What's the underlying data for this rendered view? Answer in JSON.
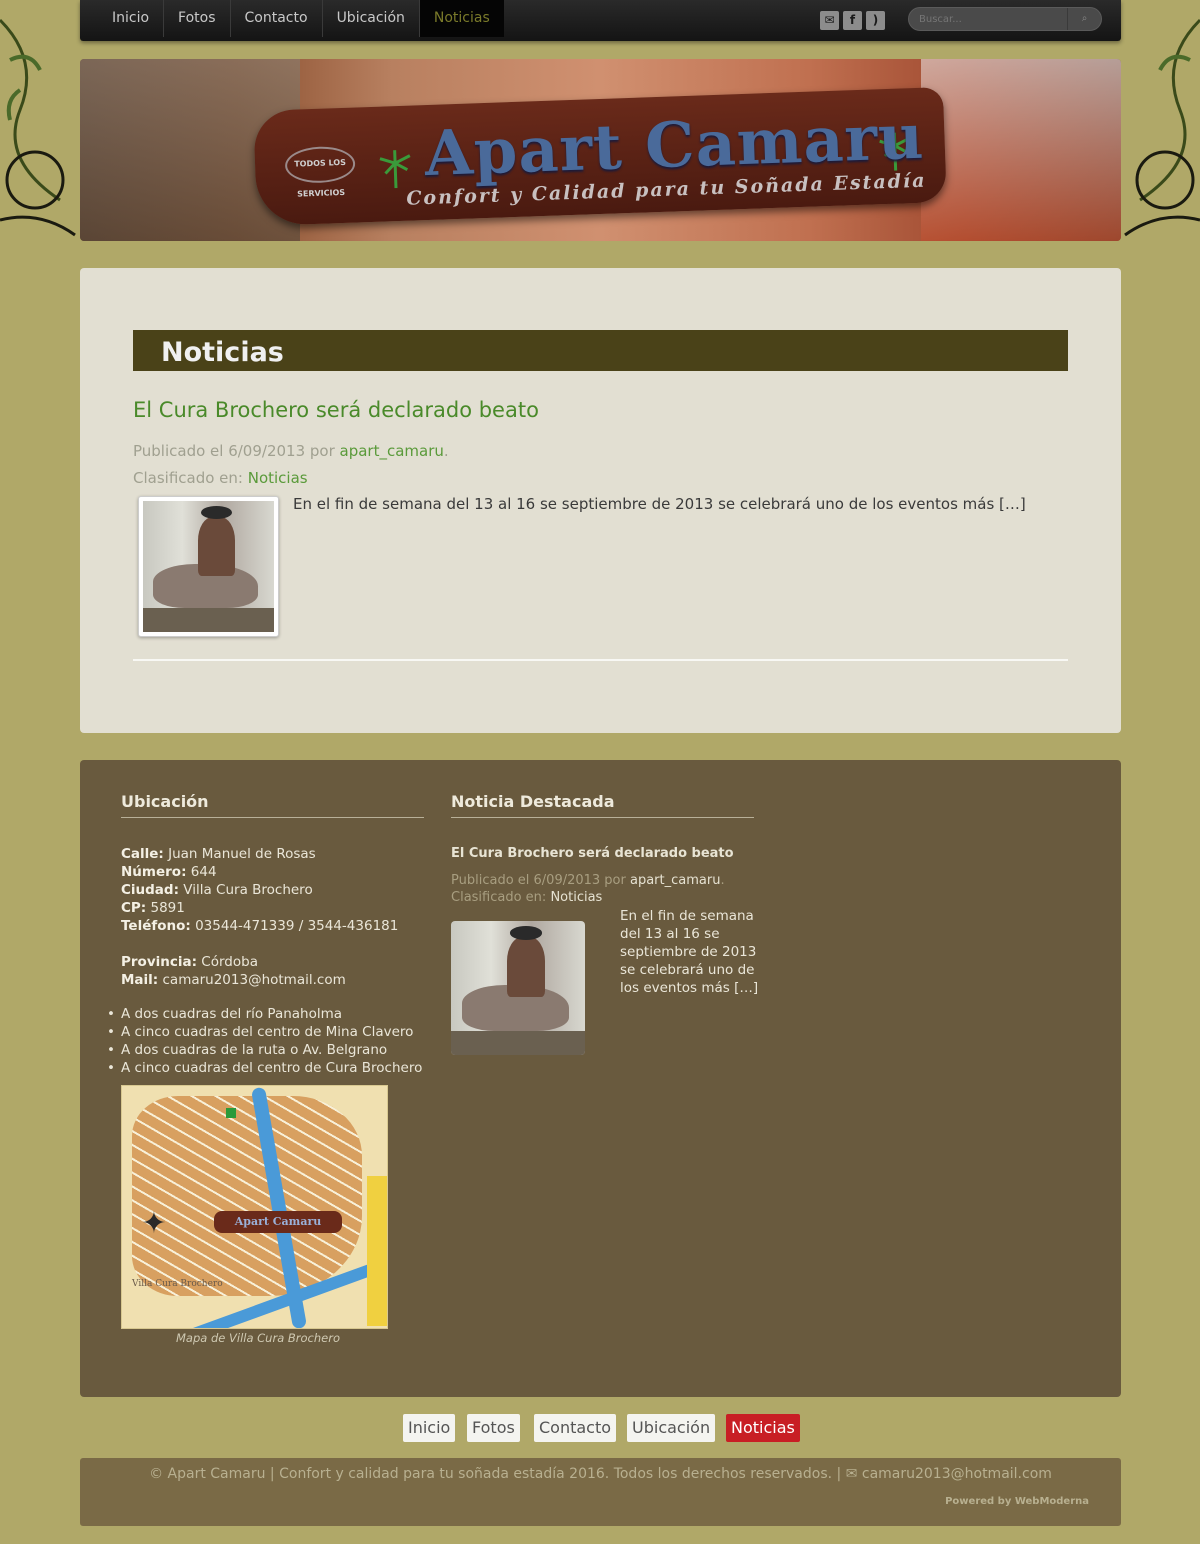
{
  "nav": {
    "items": [
      {
        "label": "Inicio"
      },
      {
        "label": "Fotos"
      },
      {
        "label": "Contacto"
      },
      {
        "label": "Ubicación"
      },
      {
        "label": "Noticias",
        "active": true
      }
    ],
    "search_placeholder": "Buscar...",
    "social_icons": [
      "mail-icon",
      "facebook-icon",
      "rss-icon"
    ]
  },
  "banner": {
    "brand": "Apart Camaru",
    "tagline": "Confort y Calidad para tu Soñada Estadía",
    "badge": "TODOS LOS SERVICIOS"
  },
  "main": {
    "section_title": "Noticias",
    "post": {
      "title": "El Cura Brochero será declarado beato",
      "published_prefix": "Publicado el 6/09/2013 por ",
      "author": "apart_camaru",
      "published_suffix": ".",
      "category_prefix": "Clasificado en: ",
      "category": "Noticias",
      "excerpt": "En el fin de semana del 13 al 16 se septiembre de 2013 se celebrará uno de los eventos más […]"
    }
  },
  "footer_widgets": {
    "location": {
      "title": "Ubicación",
      "fields": [
        {
          "label": "Calle:",
          "value": " Juan Manuel de Rosas"
        },
        {
          "label": "Número:",
          "value": " 644"
        },
        {
          "label": "Ciudad:",
          "value": " Villa Cura Brochero"
        },
        {
          "label": "CP:",
          "value": " 5891"
        },
        {
          "label": "Teléfono:",
          "value": " 03544-471339 / 3544-436181"
        },
        {
          "label": "Provincia:",
          "value": " Córdoba"
        },
        {
          "label": "Mail:",
          "value": " camaru2013@hotmail.com"
        }
      ],
      "bullets": [
        "A dos cuadras del río Panaholma",
        "A cinco cuadras del centro de Mina Clavero",
        "A dos cuadras de la ruta o Av. Belgrano",
        "A cinco cuadras del centro de Cura Brochero"
      ],
      "map_caption": "Mapa de Villa Cura Brochero",
      "map_text": "Villa Cura Brochero"
    },
    "featured": {
      "title": "Noticia Destacada",
      "post_title": "El Cura Brochero será declarado beato",
      "published_prefix": "Publicado el 6/09/2013 por ",
      "author": "apart_camaru",
      "published_suffix": ".",
      "category_prefix": "Clasificado en: ",
      "category": "Noticias",
      "excerpt": "En el fin de semana del 13 al 16 se septiembre de 2013 se celebrará uno de los eventos más […]"
    }
  },
  "bottom_nav": [
    "Inicio",
    "Fotos",
    "Contacto",
    "Ubicación",
    "Noticias"
  ],
  "copyright": {
    "text": "© Apart Camaru | Confort y calidad para tu soñada estadía 2016. Todos los derechos reservados. | ",
    "email": "camaru2013@hotmail.com",
    "powered": "Powered by WebModerna"
  },
  "colors": {
    "background": "#b0a868",
    "section_title_bg": "#4a4218",
    "link_green": "#4a8a2a",
    "footer_bg": "#695a3e",
    "active_red": "#c81e24"
  }
}
